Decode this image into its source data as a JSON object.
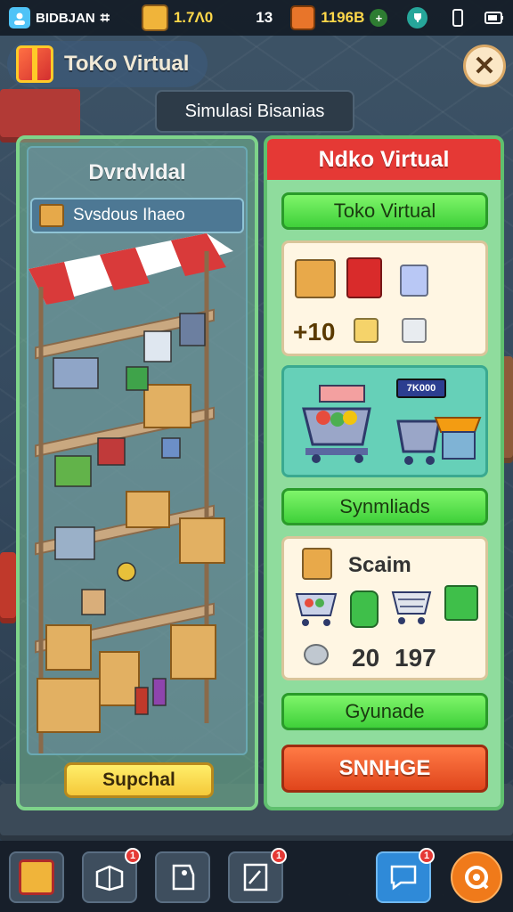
{
  "status_bar": {
    "player_name": "BIDBJAN",
    "currency_1": "1.7Λ0",
    "level": "13",
    "currency_2": "1196B",
    "icons": [
      "profile-icon",
      "grid-icon",
      "crate-coin-icon",
      "treasure-icon",
      "trophy-icon",
      "phone-icon",
      "battery-icon"
    ]
  },
  "header": {
    "title": "ToKo Virtual",
    "close_label": "✕"
  },
  "sim_tag": "Simulasi Bisanias",
  "left_panel": {
    "title": "Dvrdvldal",
    "selected_item": "Svsdous Ihaeo",
    "button_label": "Supchal"
  },
  "right_panel": {
    "header": "Ndko Virtual",
    "sub_button": "Toko Virtual",
    "inventory_card": {
      "count_label": "+10",
      "icons": [
        "cardboard-box-icon",
        "red-crate-icon",
        "blue-cube-icon",
        "yellow-cube-icon",
        "white-cube-icon"
      ]
    },
    "carts_card": {
      "sign_label": "7K000"
    },
    "mid_button": "Synmliads",
    "stats_card": {
      "label": "Scaim",
      "value_1": "20",
      "value_2": "197"
    },
    "lower_button": "Gyunade",
    "action_button": "SNNHGE"
  },
  "bottom_nav": {
    "items": [
      {
        "icon": "gift-crate-icon",
        "badge": ""
      },
      {
        "icon": "box-map-icon",
        "badge": "1"
      },
      {
        "icon": "tag-icon",
        "badge": ""
      },
      {
        "icon": "note-icon",
        "badge": "1"
      },
      {
        "icon": "chat-icon",
        "badge": "1"
      },
      {
        "icon": "settings-icon",
        "badge": ""
      }
    ]
  },
  "colors": {
    "header_red": "#e53935",
    "button_green": "#3fd03a",
    "button_orange": "#e0451c",
    "button_yellow": "#f5c93a",
    "panel_green": "#8fdc9d"
  }
}
